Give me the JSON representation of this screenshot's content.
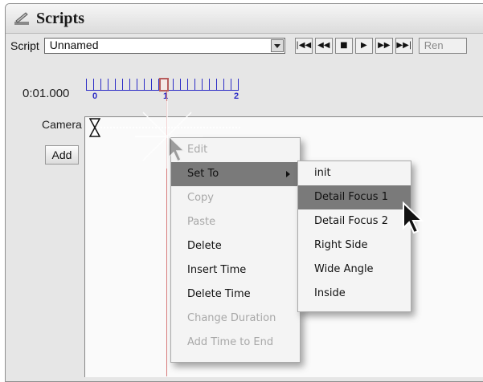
{
  "window": {
    "title": "Scripts"
  },
  "toolbar": {
    "script_label": "Script",
    "script_value": "Unnamed",
    "buttons": [
      "go-to-start",
      "step-back",
      "stop",
      "play",
      "step-forward",
      "go-to-end"
    ],
    "rename_label": "Ren"
  },
  "timeline": {
    "timecode": "0:01.000",
    "tick_labels": [
      "0",
      "1",
      "2"
    ],
    "playhead_time": 1.0
  },
  "tracks": {
    "camera_label": "Camera",
    "add_label": "Add"
  },
  "context_menu": {
    "items": [
      {
        "label": "Edit",
        "enabled": false
      },
      {
        "label": "Set To",
        "enabled": true,
        "highlighted": true,
        "submenu": true
      },
      {
        "label": "Copy",
        "enabled": false
      },
      {
        "label": "Paste",
        "enabled": false
      },
      {
        "label": "Delete",
        "enabled": true
      },
      {
        "label": "Insert Time",
        "enabled": true
      },
      {
        "label": "Delete Time",
        "enabled": true
      },
      {
        "label": "Change Duration",
        "enabled": false
      },
      {
        "label": "Add Time to End",
        "enabled": false
      }
    ]
  },
  "submenu": {
    "items": [
      {
        "label": "init"
      },
      {
        "label": "Detail Focus 1",
        "highlighted": true
      },
      {
        "label": "Detail Focus 2"
      },
      {
        "label": "Right Side"
      },
      {
        "label": "Wide Angle"
      },
      {
        "label": "Inside"
      }
    ]
  },
  "colors": {
    "highlight": "#7a7a7a",
    "ruler": "#2c2cc6",
    "playhead": "#b75d5d"
  }
}
